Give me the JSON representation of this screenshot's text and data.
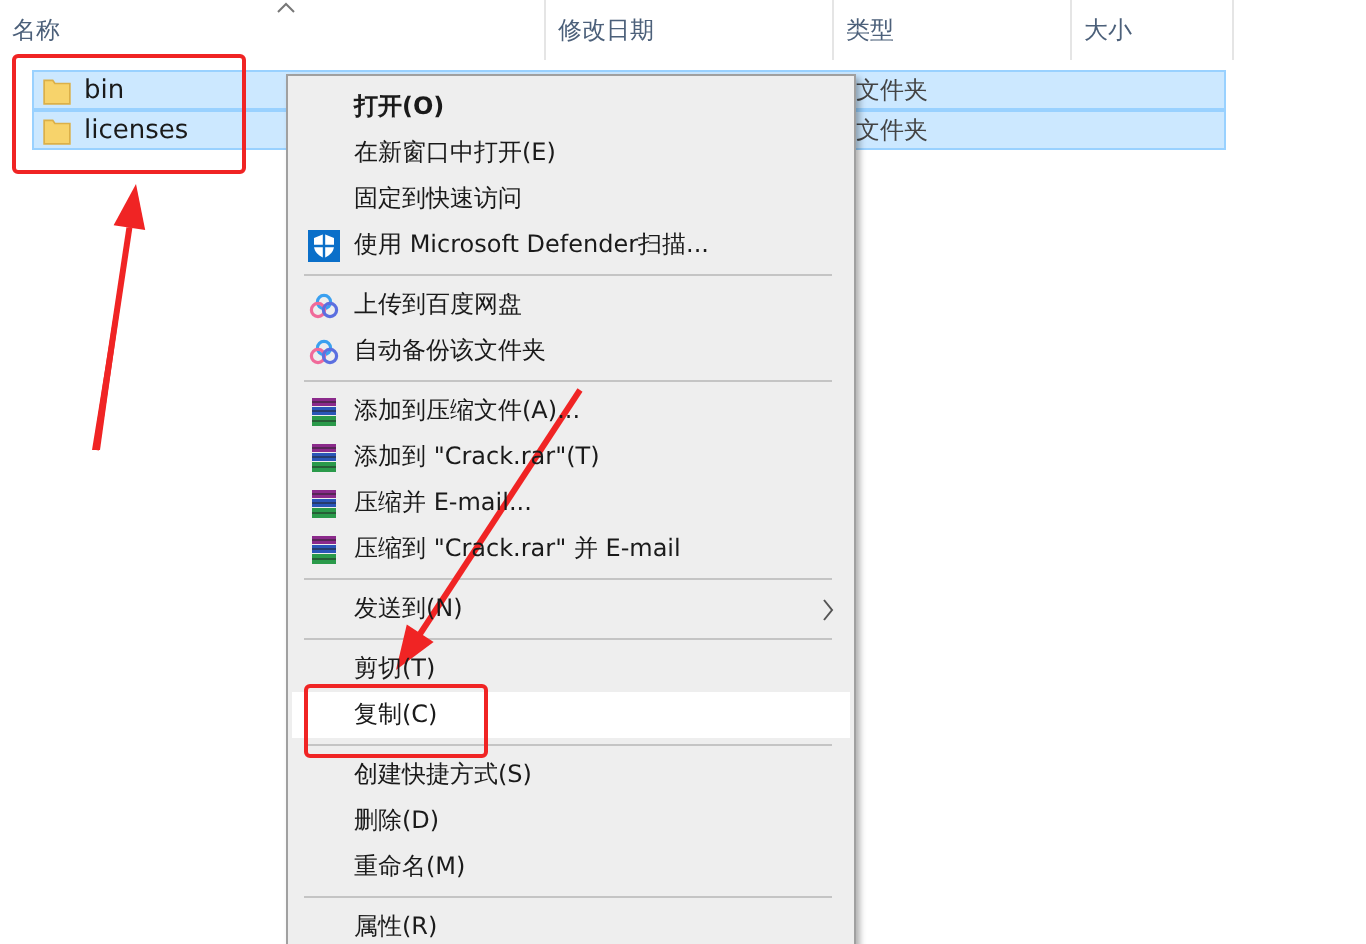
{
  "columns": [
    {
      "label": "名称",
      "sorted": true
    },
    {
      "label": "修改日期",
      "sorted": false
    },
    {
      "label": "类型",
      "sorted": false
    },
    {
      "label": "大小",
      "sorted": false
    }
  ],
  "rows": [
    {
      "name": "bin",
      "type": "文件夹",
      "selected": true
    },
    {
      "name": "licenses",
      "type": "文件夹",
      "selected": true
    }
  ],
  "context_menu": [
    {
      "kind": "item",
      "label": "打开(O)",
      "bold": true,
      "highlighted": false,
      "submenu": false
    },
    {
      "kind": "item",
      "label": "在新窗口中打开(E)",
      "bold": false,
      "highlighted": false,
      "submenu": false
    },
    {
      "kind": "item",
      "label": "固定到快速访问",
      "bold": false,
      "highlighted": false,
      "submenu": false
    },
    {
      "kind": "shield",
      "label": "使用 Microsoft Defender扫描...",
      "bold": false,
      "highlighted": false,
      "submenu": false
    },
    {
      "kind": "separator"
    },
    {
      "kind": "cloud",
      "label": "上传到百度网盘",
      "bold": false,
      "highlighted": false,
      "submenu": false
    },
    {
      "kind": "cloud",
      "label": "自动备份该文件夹",
      "bold": false,
      "highlighted": false,
      "submenu": false
    },
    {
      "kind": "separator"
    },
    {
      "kind": "archive",
      "label": "添加到压缩文件(A)...",
      "bold": false,
      "highlighted": false,
      "submenu": false
    },
    {
      "kind": "archive",
      "label": "添加到 \"Crack.rar\"(T)",
      "bold": false,
      "highlighted": false,
      "submenu": false
    },
    {
      "kind": "archive",
      "label": "压缩并 E-mail...",
      "bold": false,
      "highlighted": false,
      "submenu": false
    },
    {
      "kind": "archive",
      "label": "压缩到 \"Crack.rar\" 并 E-mail",
      "bold": false,
      "highlighted": false,
      "submenu": false
    },
    {
      "kind": "separator"
    },
    {
      "kind": "item",
      "label": "发送到(N)",
      "bold": false,
      "highlighted": false,
      "submenu": true
    },
    {
      "kind": "separator"
    },
    {
      "kind": "item",
      "label": "剪切(T)",
      "bold": false,
      "highlighted": false,
      "submenu": false
    },
    {
      "kind": "item",
      "label": "复制(C)",
      "bold": false,
      "highlighted": true,
      "submenu": false
    },
    {
      "kind": "separator"
    },
    {
      "kind": "item",
      "label": "创建快捷方式(S)",
      "bold": false,
      "highlighted": false,
      "submenu": false
    },
    {
      "kind": "item",
      "label": "删除(D)",
      "bold": false,
      "highlighted": false,
      "submenu": false
    },
    {
      "kind": "item",
      "label": "重命名(M)",
      "bold": false,
      "highlighted": false,
      "submenu": false
    },
    {
      "kind": "separator"
    },
    {
      "kind": "item",
      "label": "属性(R)",
      "bold": false,
      "highlighted": false,
      "submenu": false
    }
  ]
}
